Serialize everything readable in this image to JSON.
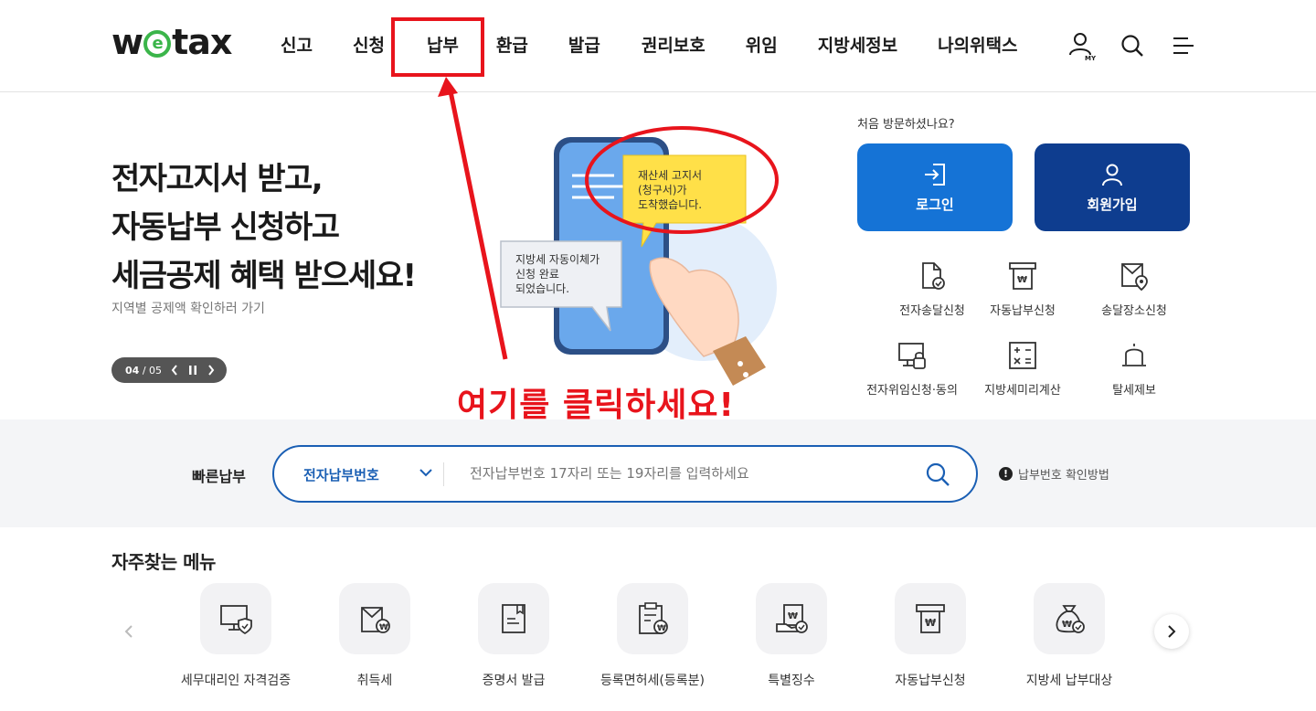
{
  "header": {
    "logo_text": "wetax",
    "nav": [
      {
        "label": "신고"
      },
      {
        "label": "신청"
      },
      {
        "label": "납부"
      },
      {
        "label": "환급"
      },
      {
        "label": "발급"
      },
      {
        "label": "권리보호"
      },
      {
        "label": "위임"
      },
      {
        "label": "지방세정보"
      },
      {
        "label": "나의위택스"
      }
    ],
    "my_label": "MY",
    "icons": [
      "user-my-icon",
      "search-icon",
      "menu-icon"
    ]
  },
  "hero": {
    "title_lines": [
      "전자고지서 받고,",
      "자동납부 신청하고",
      "세금공제 혜택 받으세요!"
    ],
    "subtitle": "지역별 공제액 확인하러 가기",
    "pager": {
      "current": "04",
      "total": "/ 05"
    },
    "bubble_yellow": [
      "재산세 고지서",
      "(청구서)가",
      "도착했습니다."
    ],
    "bubble_gray": [
      "지방세 자동이체가",
      "신청 완료",
      "되었습니다."
    ]
  },
  "side": {
    "visit_text": "처음 방문하셨나요?",
    "login_label": "로그인",
    "join_label": "회원가입",
    "quick_links": [
      {
        "label": "전자송달신청",
        "icon": "e-delivery-icon"
      },
      {
        "label": "자동납부신청",
        "icon": "auto-pay-icon"
      },
      {
        "label": "송달장소신청",
        "icon": "delivery-location-icon"
      },
      {
        "label": "전자위임신청·동의",
        "icon": "e-delegation-icon"
      },
      {
        "label": "지방세미리계산",
        "icon": "calculator-icon"
      },
      {
        "label": "탈세제보",
        "icon": "report-bell-icon"
      }
    ]
  },
  "fast_pay": {
    "label": "빠른납부",
    "select_value": "전자납부번호",
    "placeholder": "전자납부번호 17자리 또는 19자리를 입력하세요",
    "help_text": "납부번호 확인방법",
    "help_mark": "!"
  },
  "frequent": {
    "title": "자주찾는 메뉴",
    "items": [
      {
        "label": "세무대리인 자격검증",
        "icon": "monitor-shield-icon"
      },
      {
        "label": "취득세",
        "icon": "acquisition-tax-icon"
      },
      {
        "label": "증명서 발급",
        "icon": "certificate-icon"
      },
      {
        "label": "등록면허세(등록분)",
        "icon": "registration-tax-icon"
      },
      {
        "label": "특별징수",
        "icon": "special-collection-icon"
      },
      {
        "label": "자동납부신청",
        "icon": "auto-pay-icon"
      },
      {
        "label": "지방세 납부대상",
        "icon": "money-bag-icon"
      }
    ]
  },
  "annotation": {
    "text": "여기를 클릭하세요!",
    "color": "#e8141c"
  }
}
